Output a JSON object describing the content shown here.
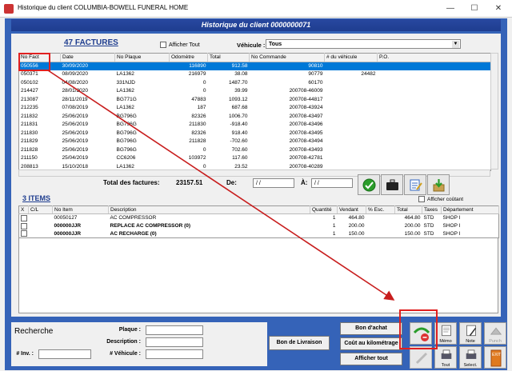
{
  "window": {
    "title": "Historique du client COLUMBIA-BOWELL FUNERAL HOME"
  },
  "header": {
    "title": "Historique du client 0000000071"
  },
  "factures": {
    "title": "47  FACTURES",
    "afficher_tout": "Afficher Tout",
    "vehicule_label": "Véhicule :",
    "vehicule_value": "Tous",
    "columns": [
      "No Fact",
      "Date",
      "No Plaque",
      "Odomètre",
      "Total",
      "No Commande",
      "# du véhicule",
      "P.O."
    ],
    "rows": [
      [
        "050556",
        "30/09/2020",
        "",
        "116890",
        "912.58",
        "90810",
        "",
        ""
      ],
      [
        "050371",
        "08/09/2020",
        "LA1362",
        "216979",
        "38.08",
        "90779",
        "24482",
        ""
      ],
      [
        "050102",
        "04/08/2020",
        "331NJD",
        "0",
        "1487.70",
        "60170",
        "",
        ""
      ],
      [
        "214427",
        "28/01/2020",
        "LA1362",
        "0",
        "39.99",
        "200708-46009",
        "",
        ""
      ],
      [
        "213087",
        "28/11/2019",
        "BG771G",
        "47883",
        "1093.12",
        "200708-44817",
        "",
        ""
      ],
      [
        "212235",
        "07/08/2019",
        "LA1362",
        "187",
        "687.68",
        "200708-43924",
        "",
        ""
      ],
      [
        "211832",
        "25/06/2019",
        "BG796G",
        "82326",
        "1006.70",
        "200708-43497",
        "",
        ""
      ],
      [
        "211831",
        "25/06/2019",
        "BG796G",
        "211830",
        "-918.40",
        "200708-43496",
        "",
        ""
      ],
      [
        "211830",
        "25/06/2019",
        "BG796G",
        "82326",
        "918.40",
        "200708-43495",
        "",
        ""
      ],
      [
        "211829",
        "25/06/2019",
        "BG796G",
        "211828",
        "-702.60",
        "200708-43494",
        "",
        ""
      ],
      [
        "211828",
        "25/06/2019",
        "BG796G",
        "0",
        "702.60",
        "200708-43493",
        "",
        ""
      ],
      [
        "211150",
        "25/04/2019",
        "CC6206",
        "103972",
        "117.60",
        "200708-42781",
        "",
        ""
      ],
      [
        "208813",
        "15/10/2018",
        "LA1362",
        "0",
        "23.52",
        "200708-40289",
        "",
        ""
      ]
    ],
    "total_label": "Total des factures:",
    "total_value": "23157.51",
    "de_label": "De:",
    "date_from": "/   /",
    "a_label": "À:",
    "date_to": "/   /"
  },
  "items": {
    "title": "3  ITEMS",
    "afficher_couteant": "Afficher coûtant",
    "columns": [
      "X",
      "C/L",
      "No Item",
      "Description",
      "Quantité",
      "Vendant",
      "% Esc.",
      "Total",
      "Taxes",
      "Département"
    ],
    "rows": [
      [
        "",
        "",
        "00050127",
        "AC COMPRESSOR",
        "1",
        "464.80",
        "",
        "464.80",
        "STD",
        "SHOP I"
      ],
      [
        "",
        "",
        "000000JJR",
        "REPLACE AC COMPRESSOR (0)",
        "1",
        "200.00",
        "",
        "200.00",
        "STD",
        "SHOP I"
      ],
      [
        "",
        "",
        "000000JJR",
        "AC RECHARGE (0)",
        "1",
        "150.00",
        "",
        "150.00",
        "STD",
        "SHOP I"
      ]
    ]
  },
  "search": {
    "title": "Recherche",
    "plaque_label": "Plaque :",
    "description_label": "Description :",
    "vehicule_label": "# Véhicule :",
    "inv_label": "# Inv. :"
  },
  "buttons": {
    "bon_livraison": "Bon de Livraison",
    "bon_achat": "Bon d'achat",
    "cout_km": "Coût au kilométrage",
    "afficher_tout": "Afficher tout",
    "memo": "Mémo",
    "note": "Note",
    "punch": "Punch",
    "tout": "Tout",
    "select": "Select."
  },
  "colors": {
    "accent_blue": "#3563b8",
    "header_blue": "#1e3d8f",
    "selection": "#0078d7",
    "highlight_red": "#e02020"
  }
}
